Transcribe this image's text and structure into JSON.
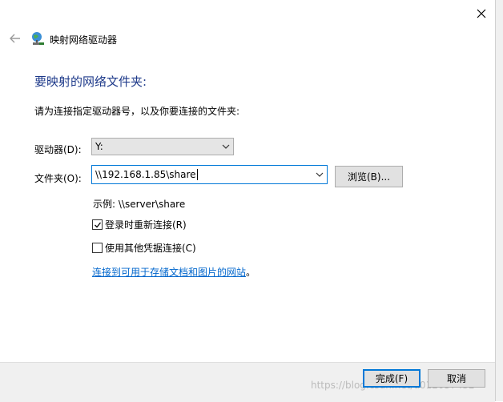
{
  "window": {
    "title": "映射网络驱动器"
  },
  "main": {
    "heading": "要映射的网络文件夹:",
    "instruction": "请为连接指定驱动器号，以及你要连接的文件夹:",
    "drive_label": "驱动器(D):",
    "drive_value": "Y:",
    "folder_label": "文件夹(O):",
    "folder_value": "\\\\192.168.1.85\\share",
    "browse_label": "浏览(B)...",
    "example_text": "示例: \\\\server\\share",
    "reconnect_label": "登录时重新连接(R)",
    "reconnect_checked": true,
    "credentials_label": "使用其他凭据连接(C)",
    "credentials_checked": false,
    "link_text": "连接到可用于存储文档和图片的网站",
    "link_suffix": "。"
  },
  "footer": {
    "finish_label": "完成(F)",
    "cancel_label": "取消",
    "watermark": "https://blog.csdn.net/u012057432"
  },
  "colors": {
    "heading": "#1e3a8a",
    "accent": "#0078d7",
    "link": "#0066cc"
  },
  "icons": {
    "close": "close-icon",
    "back": "back-arrow-icon",
    "title": "network-drive-icon",
    "dropdown": "chevron-down-icon",
    "check": "checkmark-icon"
  }
}
